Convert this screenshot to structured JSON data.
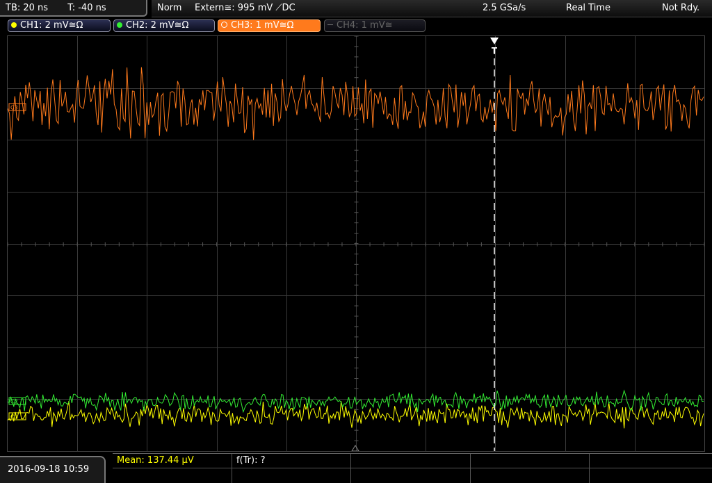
{
  "topbar": {
    "timebase": "TB: 20 ns",
    "trigger_time": "T: -40 ns"
  },
  "status": {
    "mode": "Norm",
    "trigger_source": "Extern≅: 995 mV ⟋DC",
    "sample_rate": "2.5 GSa/s",
    "acq_mode": "Real Time",
    "ready_state": "Not Rdy."
  },
  "channels": [
    {
      "label": "CH1: 2 mV≅Ω",
      "color": "#ffff00"
    },
    {
      "label": "CH2: 2 mV≅Ω",
      "color": "#33ee33"
    },
    {
      "label": "CH3: 1 mV≅Ω",
      "color": "#ff7a1c"
    },
    {
      "label": "CH4: 1 mV≅",
      "color": "#666666"
    }
  ],
  "markers": {
    "ch3_ref": "C3",
    "ch2_ref": "C2",
    "ch1_ref": "C1",
    "trigger": "T"
  },
  "datetime": "2016-09-18 10:59",
  "measurements": {
    "mean": "Mean: 137.44 µV",
    "rise_freq": "f(Tr): ?"
  }
}
